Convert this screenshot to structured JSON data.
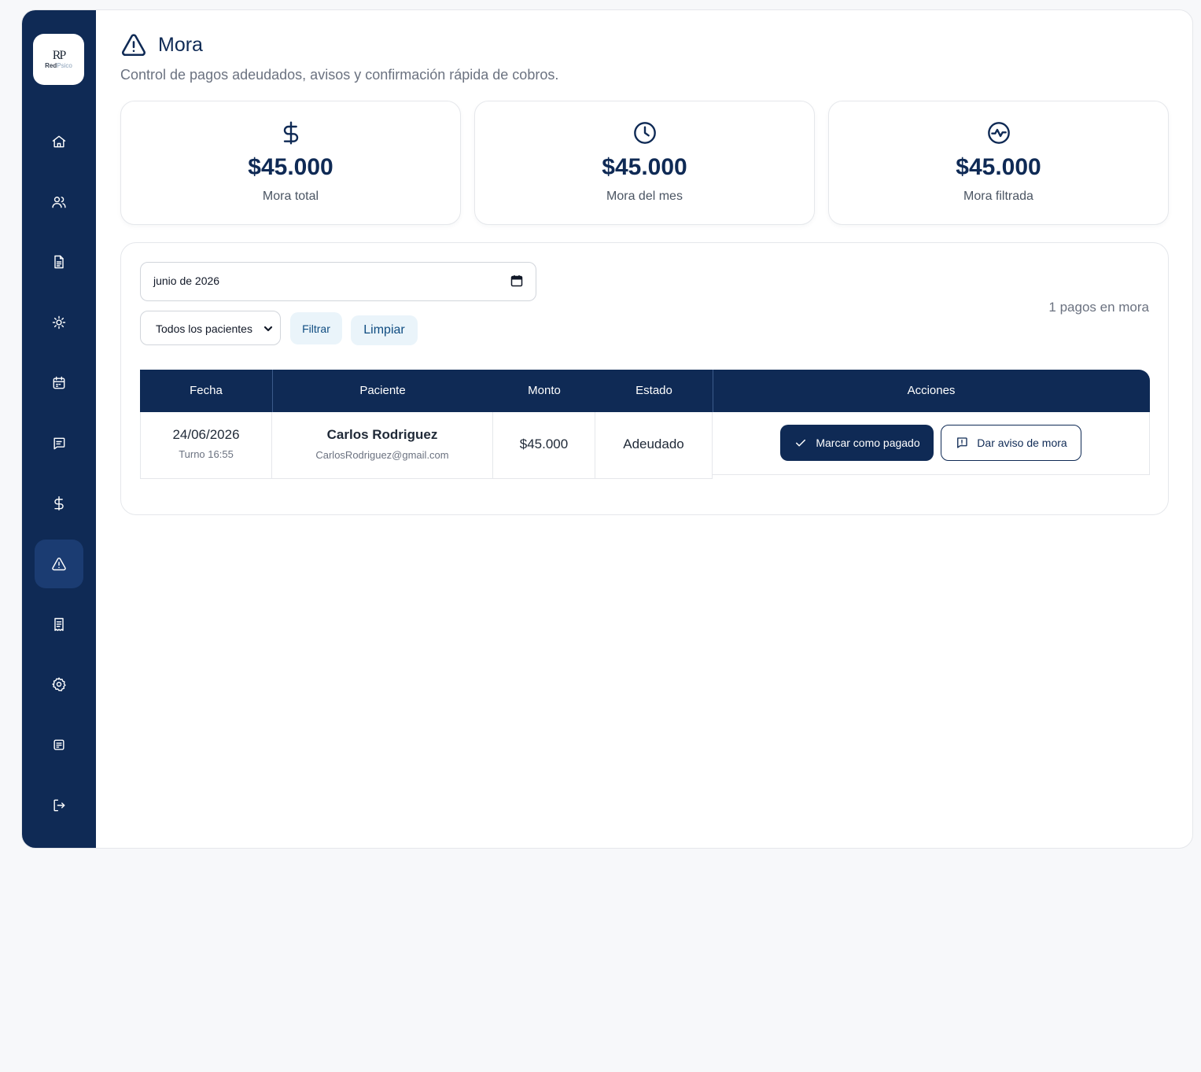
{
  "sidebar": {
    "logo": {
      "mark": "RP",
      "text_primary": "Red",
      "text_secondary": "Psico"
    },
    "items": [
      {
        "icon": "home-icon",
        "active": false
      },
      {
        "icon": "users-icon",
        "active": false
      },
      {
        "icon": "document-icon",
        "active": false
      },
      {
        "icon": "sun-icon",
        "active": false
      },
      {
        "icon": "calendar-icon",
        "active": false
      },
      {
        "icon": "message-icon",
        "active": false
      },
      {
        "icon": "dollar-icon",
        "active": false
      },
      {
        "icon": "alert-triangle-icon",
        "active": true
      },
      {
        "icon": "receipt-icon",
        "active": false
      },
      {
        "icon": "gear-icon",
        "active": false
      },
      {
        "icon": "notes-icon",
        "active": false
      },
      {
        "icon": "logout-icon",
        "active": false
      }
    ]
  },
  "header": {
    "title": "Mora",
    "subtitle": "Control de pagos adeudados, avisos y confirmación rápida de cobros."
  },
  "stats": [
    {
      "icon": "dollar-icon",
      "value": "$45.000",
      "label": "Mora total"
    },
    {
      "icon": "clock-icon",
      "value": "$45.000",
      "label": "Mora del mes"
    },
    {
      "icon": "activity-icon",
      "value": "$45.000",
      "label": "Mora filtrada"
    }
  ],
  "filters": {
    "month_value": "junio de 2026",
    "patient_select": "Todos los pacientes",
    "filter_label": "Filtrar",
    "clear_label": "Limpiar",
    "count_text": "1 pagos en mora"
  },
  "table": {
    "columns": [
      "Fecha",
      "Paciente",
      "Monto",
      "Estado",
      "Acciones"
    ],
    "rows": [
      {
        "date": "24/06/2026",
        "turno": "Turno 16:55",
        "patient_name": "Carlos Rodriguez",
        "patient_email": "CarlosRodriguez@gmail.com",
        "amount": "$45.000",
        "status": "Adeudado",
        "action_paid": "Marcar como pagado",
        "action_notice": "Dar aviso de mora"
      }
    ]
  },
  "colors": {
    "primary": "#0f2a55",
    "accent_bg": "#eaf4fa",
    "accent_text": "#0f4c81"
  }
}
